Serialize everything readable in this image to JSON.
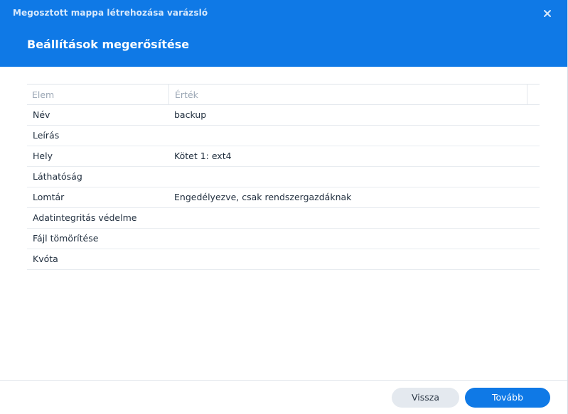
{
  "window": {
    "title": "Megosztott mappa létrehozása varázsló",
    "close_icon": "close-icon"
  },
  "step": {
    "title": "Beállítások megerősítése"
  },
  "table": {
    "columns": [
      "Elem",
      "Érték"
    ],
    "rows": [
      {
        "item": "Név",
        "value": "backup"
      },
      {
        "item": "Leírás",
        "value": ""
      },
      {
        "item": "Hely",
        "value": "Kötet 1: ext4"
      },
      {
        "item": "Láthatóság",
        "value": ""
      },
      {
        "item": "Lomtár",
        "value": "Engedélyezve, csak rendszergazdáknak"
      },
      {
        "item": "Adatintegritás védelme",
        "value": ""
      },
      {
        "item": "Fájl tömörítése",
        "value": ""
      },
      {
        "item": "Kvóta",
        "value": ""
      }
    ]
  },
  "footer": {
    "back_label": "Vissza",
    "next_label": "Tovább"
  },
  "colors": {
    "accent": "#0f79e6",
    "header_text": "#ffffff",
    "secondary_button": "#e4e9ef"
  }
}
